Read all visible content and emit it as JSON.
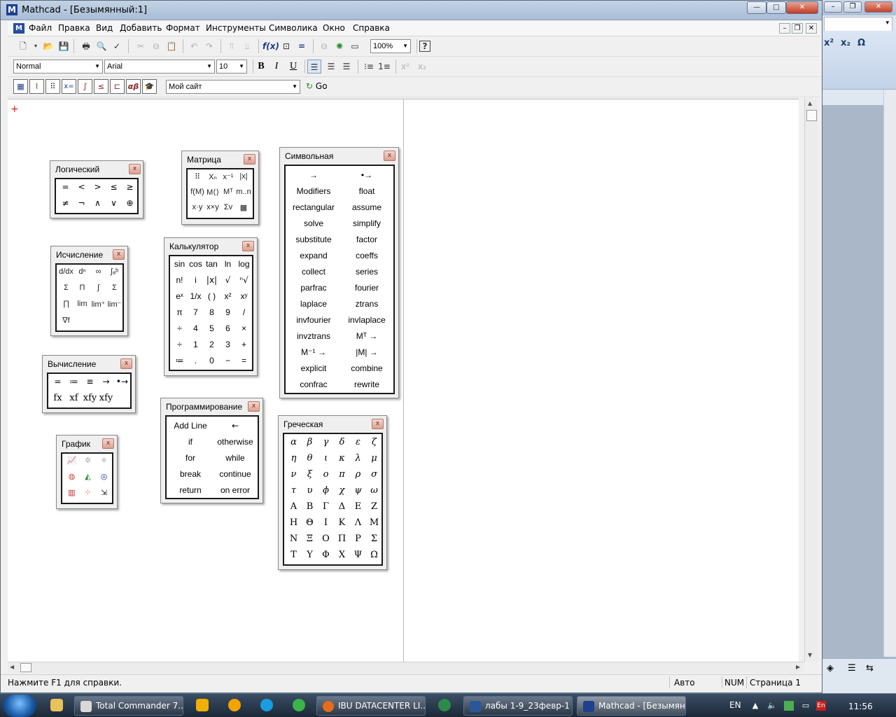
{
  "window": {
    "title": "Mathcad - [Безымянный:1]",
    "app_icon": "M",
    "caption_minimize": "—",
    "caption_maximize": "□",
    "caption_close": "✕"
  },
  "menu": {
    "items": [
      "Файл",
      "Правка",
      "Вид",
      "Добавить",
      "Формат",
      "Инструменты",
      "Символика",
      "Окно",
      "Справка"
    ],
    "mdi_minimize": "–",
    "mdi_restore": "❐",
    "mdi_close": "✕"
  },
  "toolbar_standard": {
    "zoom": "100%"
  },
  "toolbar_format": {
    "style": "Normal",
    "font": "Arial",
    "size": "10",
    "bold": "B",
    "italic": "I",
    "underline": "U"
  },
  "toolbar_math": {
    "site": "Мой сайт",
    "go_label": "Go"
  },
  "palettes": {
    "logic": {
      "title": "Логический",
      "cells": [
        "=",
        "<",
        ">",
        "≤",
        "≥",
        "≠",
        "¬",
        "∧",
        "∨",
        "⊕"
      ]
    },
    "matrix": {
      "title": "Матрица"
    },
    "symbolic": {
      "title": "Символьная",
      "cells": [
        "→",
        "•→",
        "Modifiers",
        "float",
        "rectangular",
        "assume",
        "solve",
        "simplify",
        "substitute",
        "factor",
        "expand",
        "coeffs",
        "collect",
        "series",
        "parfrac",
        "fourier",
        "laplace",
        "ztrans",
        "invfourier",
        "invlaplace",
        "invztrans",
        "Mᵀ →",
        "M⁻¹ →",
        "|M| →",
        "explicit",
        "combine",
        "confrac",
        "rewrite"
      ]
    },
    "calculus": {
      "title": "Исчисление"
    },
    "calculator": {
      "title": "Калькулятор",
      "cells": [
        "sin",
        "cos",
        "tan",
        "ln",
        "log",
        "n!",
        "i",
        "|x|",
        "√",
        "ⁿ√",
        "eˣ",
        "1/x",
        "( )",
        "x²",
        "xʸ",
        "π",
        "7",
        "8",
        "9",
        "/",
        "÷",
        "4",
        "5",
        "6",
        "×",
        "÷",
        "1",
        "2",
        "3",
        "+",
        "≔",
        ".",
        "0",
        "−",
        "="
      ]
    },
    "evaluation": {
      "title": "Вычисление",
      "cells": [
        "=",
        "≔",
        "≡",
        "→",
        "•→",
        "fx",
        "xf",
        "xfy",
        "xfy"
      ]
    },
    "graph": {
      "title": "График"
    },
    "programming": {
      "title": "Программирование",
      "cells": [
        "Add Line",
        "←",
        "if",
        "otherwise",
        "for",
        "while",
        "break",
        "continue",
        "return",
        "on error"
      ]
    },
    "greek": {
      "title": "Греческая",
      "cells": [
        "α",
        "β",
        "γ",
        "δ",
        "ε",
        "ζ",
        "η",
        "θ",
        "ι",
        "κ",
        "λ",
        "μ",
        "ν",
        "ξ",
        "ο",
        "π",
        "ρ",
        "σ",
        "τ",
        "υ",
        "ϕ",
        "χ",
        "ψ",
        "ω",
        "Α",
        "Β",
        "Γ",
        "Δ",
        "Ε",
        "Ζ",
        "Η",
        "Θ",
        "Ι",
        "Κ",
        "Λ",
        "Μ",
        "Ν",
        "Ξ",
        "Ο",
        "Π",
        "Ρ",
        "Σ",
        "Τ",
        "Υ",
        "Φ",
        "Χ",
        "Ψ",
        "Ω"
      ]
    }
  },
  "status": {
    "help": "Нажмите F1 для справки.",
    "mode": "Авто",
    "num": "NUM",
    "page": "Страница 1"
  },
  "taskbar": {
    "buttons": [
      "Total Commander 7....",
      "IBU DATACENTER LI...",
      "лабы 1-9_23февр-1 ...",
      "Mathcad - [Безымян..."
    ],
    "lang": "EN",
    "time": "11:56"
  },
  "colors": {
    "accent_red": "#d32020",
    "title_blue": "#a9bdd6"
  }
}
